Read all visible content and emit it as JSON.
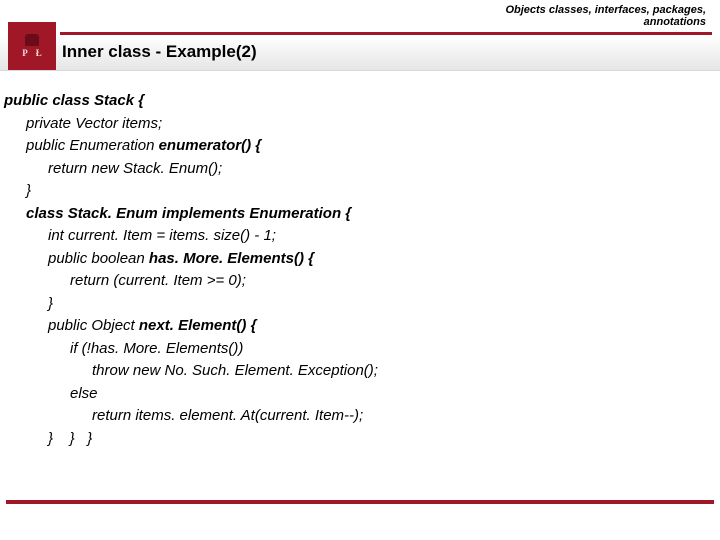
{
  "topic": {
    "line1": "Objects classes, interfaces, packages,",
    "line2": "annotations"
  },
  "logo": {
    "left": "P",
    "right": "Ł"
  },
  "title": "Inner class - Example(2)",
  "code": {
    "l0": "public class Stack {",
    "l1": "private Vector items;",
    "l2a": "public Enumeration ",
    "l2b": "enumerator() {",
    "l3": "return new Stack. Enum();",
    "l4": "}",
    "l5a": "class Stack. Enum ",
    "l5b": "implements Enumeration {",
    "l6": "int current. Item = items. size() - 1;",
    "l7a": "public boolean ",
    "l7b": "has. More. Elements() {",
    "l8": "return (current. Item >= 0);",
    "l9": "}",
    "l10a": "public Object ",
    "l10b": "next. Element() {",
    "l11": "if (!has. More. Elements())",
    "l12": "throw new No. Such. Element. Exception();",
    "l13": "else",
    "l14": "return items. element. At(current. Item--);",
    "l15": "}    }   }"
  }
}
